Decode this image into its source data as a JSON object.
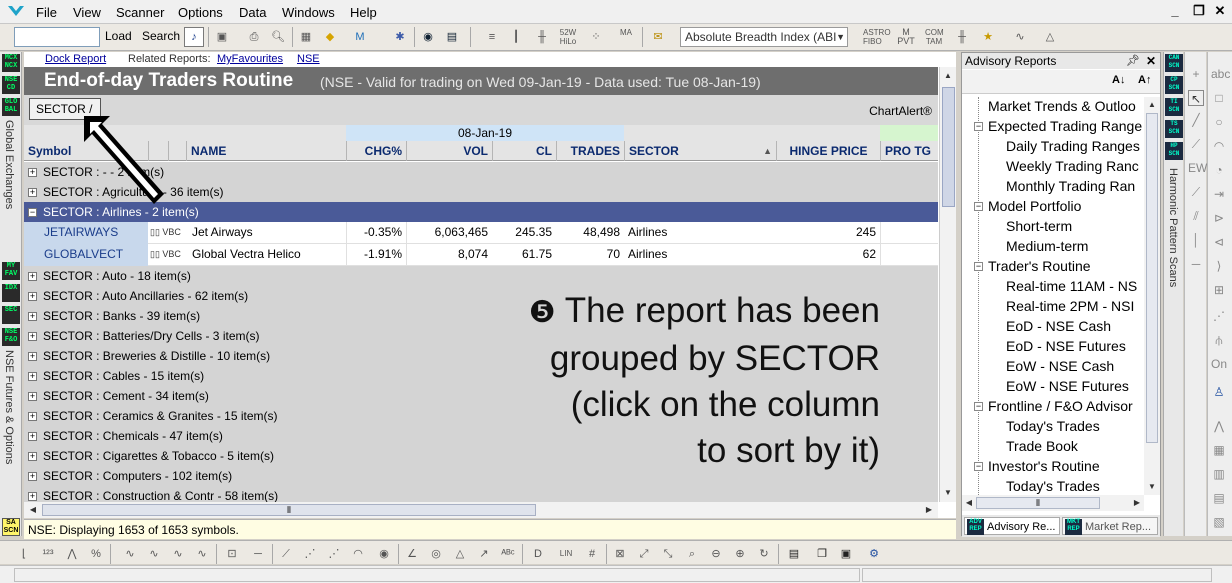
{
  "menubar": {
    "items": [
      "File",
      "View",
      "Scanner",
      "Options",
      "Data",
      "Windows",
      "Help"
    ],
    "window_controls": [
      "_",
      "❐",
      "✕"
    ]
  },
  "toolbar": {
    "symbol_value": "",
    "load_label": "Load",
    "search_label": "Search",
    "breadth_select": "Absolute Breadth Index (ABI"
  },
  "left_rail": {
    "tiles_top": [
      "MCX NCX",
      "NSE CD",
      "GLO BAL"
    ],
    "label_top": "Global Exchanges",
    "tiles_mid": [
      "MY FAV",
      "IDX",
      "SEC",
      "NSE F&O"
    ],
    "label_mid": "NSE Futures & Options",
    "tile_bottom": "SA SCN"
  },
  "report": {
    "links": {
      "dock": "Dock Report",
      "related_label": "Related Reports:",
      "my_favourites": "MyFavourites",
      "nse": "NSE"
    },
    "title": "End-of-day Traders Routine",
    "subtitle": "(NSE - Valid for trading on Wed 09-Jan-19 - Data used: Tue 08-Jan-19)",
    "group_chip": "SECTOR  /",
    "chartalert": "ChartAlert®",
    "date_band": "08-Jan-19",
    "columns": [
      "Symbol",
      "NAME",
      "CHG%",
      "VOL",
      "CL",
      "TRADES",
      "SECTOR",
      "HINGE PRICE",
      "PRO TG"
    ],
    "sort_indicator": "▲"
  },
  "groups_before": [
    "SECTOR : - - 2 item(s)",
    "SECTOR : Agriculture - 36 item(s)"
  ],
  "group_open": "SECTOR : Airlines - 2 item(s)",
  "rows": [
    {
      "symbol": "JETAIRWAYS",
      "icons": "VBC",
      "name": "Jet Airways",
      "chg": "-0.35%",
      "vol": "6,063,465",
      "cl": "245.35",
      "trades": "48,498",
      "sector": "Airlines",
      "hinge": "245"
    },
    {
      "symbol": "GLOBALVECT",
      "icons": "VBC",
      "name": "Global Vectra Helico",
      "chg": "-1.91%",
      "vol": "8,074",
      "cl": "61.75",
      "trades": "70",
      "sector": "Airlines",
      "hinge": "62"
    }
  ],
  "groups_after": [
    "SECTOR : Auto - 18 item(s)",
    "SECTOR : Auto Ancillaries - 62 item(s)",
    "SECTOR : Banks - 39 item(s)",
    "SECTOR : Batteries/Dry Cells - 3 item(s)",
    "SECTOR : Breweries & Distille - 10 item(s)",
    "SECTOR : Cables - 15 item(s)",
    "SECTOR : Cement - 34 item(s)",
    "SECTOR : Ceramics & Granites - 15 item(s)",
    "SECTOR : Chemicals - 47 item(s)",
    "SECTOR : Cigarettes & Tobacco - 5 item(s)",
    "SECTOR : Computers - 102 item(s)",
    "SECTOR : Construction & Contr - 58 item(s)"
  ],
  "caption": {
    "bullet": "❺",
    "lines": [
      "The report has been",
      "grouped by SECTOR",
      "(click on the column",
      "to sort by it)"
    ]
  },
  "status": "NSE: Displaying 1653 of 1653 symbols.",
  "advisory": {
    "title": "Advisory Reports",
    "sort_az": "A↓",
    "sort_za": "A↑",
    "tree": [
      {
        "label": "Market Trends & Outloo",
        "level": 0,
        "box": ""
      },
      {
        "label": "Expected Trading Range",
        "level": 0,
        "box": "−"
      },
      {
        "label": "Daily Trading Ranges",
        "level": 1,
        "box": ""
      },
      {
        "label": "Weekly Trading Ranc",
        "level": 1,
        "box": ""
      },
      {
        "label": "Monthly Trading Ran",
        "level": 1,
        "box": ""
      },
      {
        "label": "Model Portfolio",
        "level": 0,
        "box": "−"
      },
      {
        "label": "Short-term",
        "level": 1,
        "box": ""
      },
      {
        "label": "Medium-term",
        "level": 1,
        "box": ""
      },
      {
        "label": "Trader's Routine",
        "level": 0,
        "box": "−"
      },
      {
        "label": "Real-time 11AM - NS",
        "level": 1,
        "box": ""
      },
      {
        "label": "Real-time 2PM - NSI",
        "level": 1,
        "box": ""
      },
      {
        "label": "EoD - NSE Cash",
        "level": 1,
        "box": ""
      },
      {
        "label": "EoD - NSE Futures",
        "level": 1,
        "box": ""
      },
      {
        "label": "EoW - NSE Cash",
        "level": 1,
        "box": ""
      },
      {
        "label": "EoW - NSE Futures",
        "level": 1,
        "box": ""
      },
      {
        "label": "Frontline / F&O Advisor",
        "level": 0,
        "box": "−"
      },
      {
        "label": "Today's Trades",
        "level": 1,
        "box": ""
      },
      {
        "label": "Trade Book",
        "level": 1,
        "box": ""
      },
      {
        "label": "Investor's Routine",
        "level": 0,
        "box": "−"
      },
      {
        "label": "Today's Trades",
        "level": 1,
        "box": ""
      }
    ],
    "tabs": [
      {
        "icon": "ADV REP",
        "label": "Advisory Re..."
      },
      {
        "icon": "MKT REP",
        "label": "Market Rep..."
      }
    ]
  },
  "right_rail": {
    "tiles": [
      "CAN SCN",
      "CP SCN",
      "TI SCN",
      "TS SCN",
      "HP SCN"
    ],
    "label": "Harmonic Pattern Scans"
  },
  "colors": {
    "title_bar": "#6e6e6e",
    "group_open": "#4a5a98",
    "symbol_cell": "#c8d8ec",
    "header_text": "#0b2a6f",
    "date_band": "#cfe4f7",
    "status_bar": "#fffde3"
  }
}
